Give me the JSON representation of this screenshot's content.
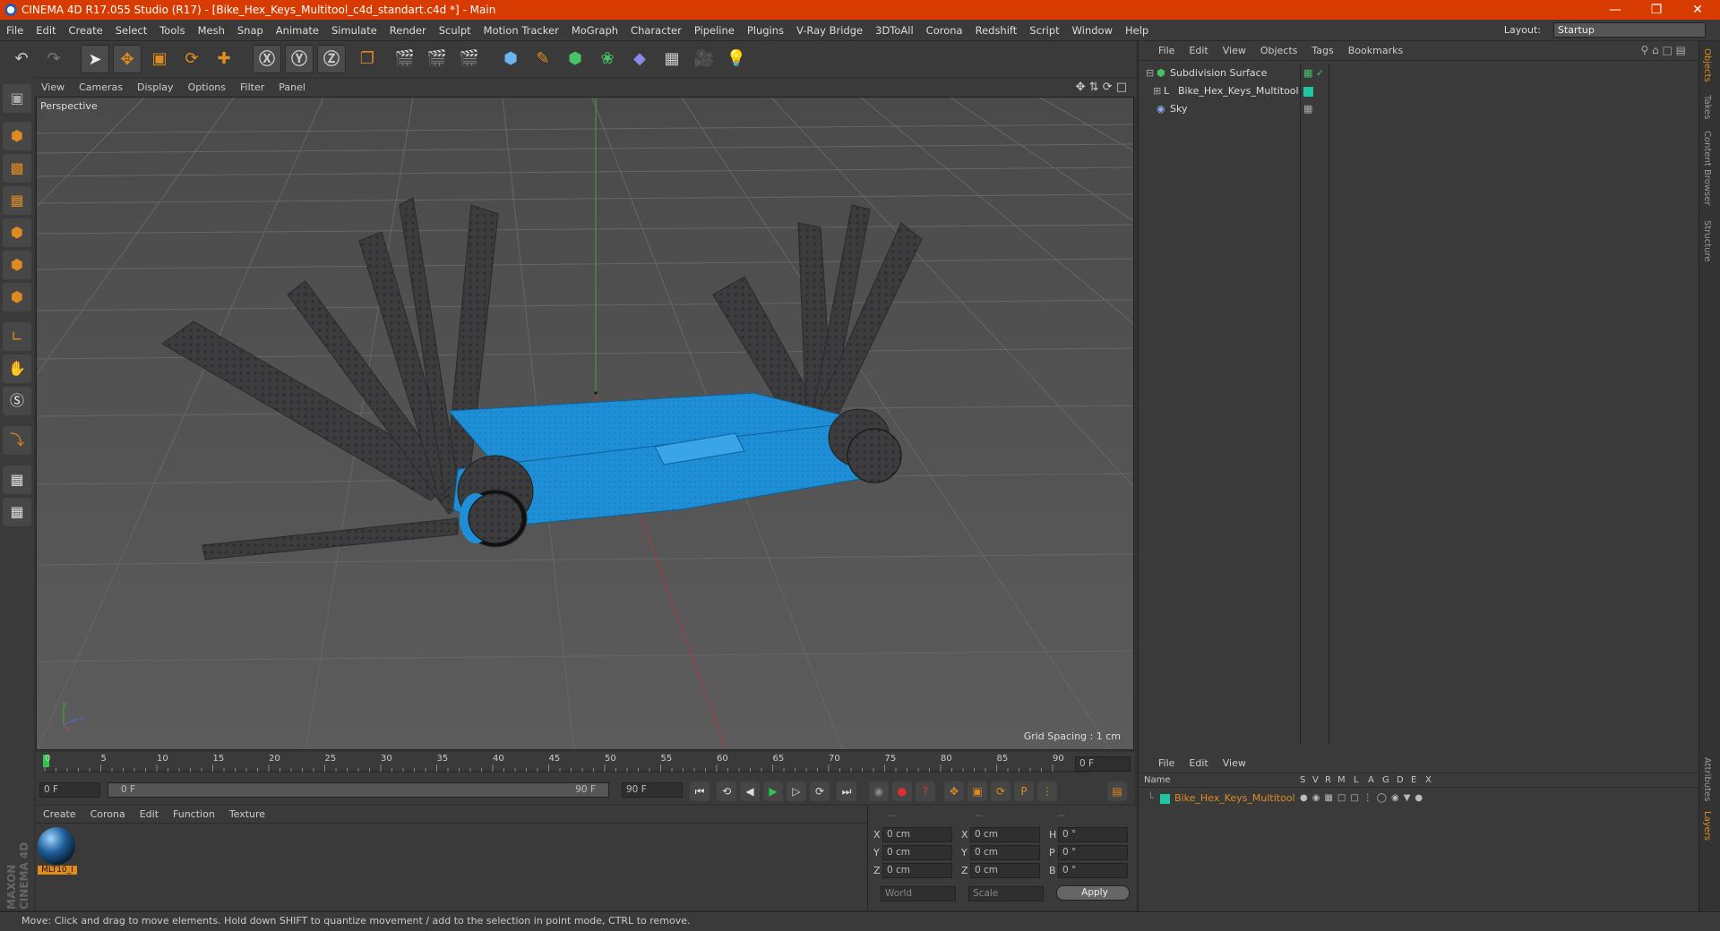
{
  "window": {
    "title": "CINEMA 4D R17.055 Studio (R17) - [Bike_Hex_Keys_Multitool_c4d_standart.c4d *] - Main"
  },
  "menu": [
    "File",
    "Edit",
    "Create",
    "Select",
    "Tools",
    "Mesh",
    "Snap",
    "Animate",
    "Simulate",
    "Render",
    "Sculpt",
    "Motion Tracker",
    "MoGraph",
    "Character",
    "Pipeline",
    "Plugins",
    "V-Ray Bridge",
    "3DToAll",
    "Corona",
    "Redshift",
    "Script",
    "Window",
    "Help"
  ],
  "layout": {
    "label": "Layout:",
    "value": "Startup"
  },
  "viewport": {
    "menu": [
      "View",
      "Cameras",
      "Display",
      "Options",
      "Filter",
      "Panel"
    ],
    "camera": "Perspective",
    "grid_spacing": "Grid Spacing : 1 cm"
  },
  "timeline": {
    "ticks": [
      "0",
      "5",
      "10",
      "15",
      "20",
      "25",
      "30",
      "35",
      "40",
      "45",
      "50",
      "55",
      "60",
      "65",
      "70",
      "75",
      "80",
      "85",
      "90"
    ],
    "current_frame": "0 F",
    "start": "0 F",
    "range_start": "0 F",
    "range_end": "90 F",
    "end": "90 F"
  },
  "material_panel": {
    "menu": [
      "Create",
      "Corona",
      "Edit",
      "Function",
      "Texture"
    ],
    "material_name": "MLT10_I"
  },
  "coords": {
    "headers": [
      "--",
      "--",
      "--"
    ],
    "rows": [
      {
        "a": "X",
        "av": "0 cm",
        "b": "X",
        "bv": "0 cm",
        "c": "H",
        "cv": "0 °"
      },
      {
        "a": "Y",
        "av": "0 cm",
        "b": "Y",
        "bv": "0 cm",
        "c": "P",
        "cv": "0 °"
      },
      {
        "a": "Z",
        "av": "0 cm",
        "b": "Z",
        "bv": "0 cm",
        "c": "B",
        "cv": "0 °"
      }
    ],
    "world": "World",
    "scale": "Scale",
    "apply": "Apply"
  },
  "object_manager": {
    "menu": [
      "File",
      "Edit",
      "View",
      "Objects",
      "Tags",
      "Bookmarks"
    ],
    "objects": [
      "Subdivision Surface",
      "Bike_Hex_Keys_Multitool",
      "Sky"
    ]
  },
  "layer_manager": {
    "menu": [
      "File",
      "Edit",
      "View"
    ],
    "columns": [
      "Name",
      "S",
      "V",
      "R",
      "M",
      "L",
      "A",
      "G",
      "D",
      "E",
      "X"
    ],
    "layer_name": "Bike_Hex_Keys_Multitool"
  },
  "side_tabs": [
    "Objects",
    "Takes",
    "Content Browser",
    "Structure",
    "Attributes",
    "Layers"
  ],
  "brand": "MAXON CINEMA 4D",
  "status": "Move: Click and drag to move elements. Hold down SHIFT to quantize movement / add to the selection in point mode, CTRL to remove.",
  "colors": {
    "titlebar": "#d83b01",
    "tool_body": "#1e8fd6",
    "accent": "#e08b20",
    "layer_color": "#1fc4a0"
  }
}
